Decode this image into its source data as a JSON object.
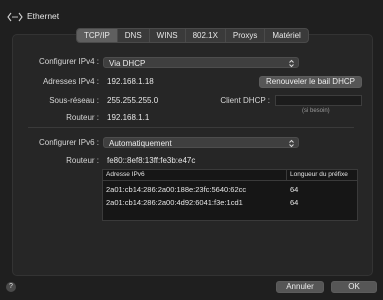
{
  "window": {
    "title": "Ethernet",
    "back_icon": "back-forward-arrows-icon"
  },
  "tabs": [
    {
      "label": "TCP/IP",
      "active": true
    },
    {
      "label": "DNS",
      "active": false
    },
    {
      "label": "WINS",
      "active": false
    },
    {
      "label": "802.1X",
      "active": false
    },
    {
      "label": "Proxys",
      "active": false
    },
    {
      "label": "Matériel",
      "active": false
    }
  ],
  "ipv4": {
    "configure_label": "Configurer IPv4 :",
    "configure_value": "Via DHCP",
    "address_label": "Adresses IPv4 :",
    "address_value": "192.168.1.18",
    "renew_button": "Renouveler le bail DHCP",
    "subnet_label": "Sous-réseau :",
    "subnet_value": "255.255.255.0",
    "dhcp_client_label": "Client DHCP :",
    "dhcp_client_value": "",
    "if_needed": "(si besoin)",
    "router_label": "Routeur :",
    "router_value": "192.168.1.1"
  },
  "ipv6": {
    "configure_label": "Configurer IPv6 :",
    "configure_value": "Automatiquement",
    "router_label": "Routeur :",
    "router_value": "fe80::8ef8:13ff:fe3b:e47c",
    "table": {
      "headers": [
        "Adresse IPv6",
        "Longueur du préfixe"
      ],
      "rows": [
        [
          "2a01:cb14:286:2a00:188e:23fc:5640:62cc",
          "64"
        ],
        [
          "2a01:cb14:286:2a00:4d92:6041:f3e:1cd1",
          "64"
        ]
      ]
    }
  },
  "footer": {
    "help": "?",
    "cancel": "Annuler",
    "ok": "OK"
  }
}
